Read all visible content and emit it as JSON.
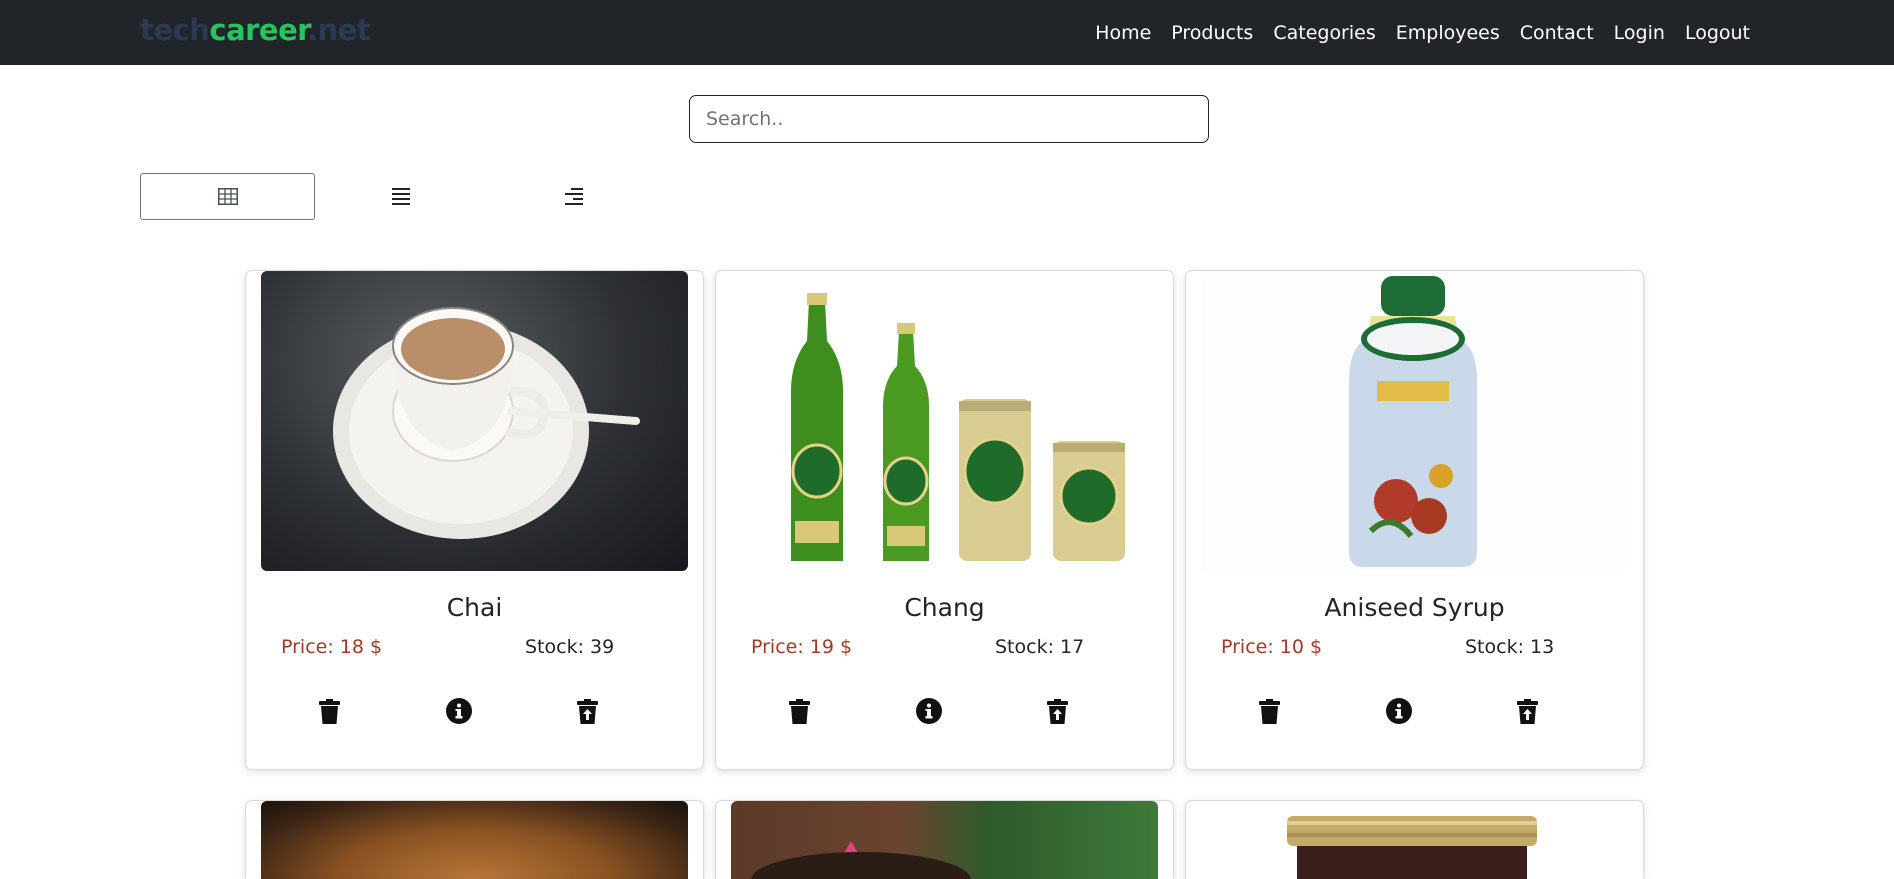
{
  "brand": {
    "part1": "tech",
    "part2": "career",
    "part3": ".net"
  },
  "nav": [
    "Home",
    "Products",
    "Categories",
    "Employees",
    "Contact",
    "Login",
    "Logout"
  ],
  "search": {
    "placeholder": "Search..",
    "value": ""
  },
  "view_toggles": [
    {
      "icon": "grid-icon",
      "active": true
    },
    {
      "icon": "list-icon",
      "active": false
    },
    {
      "icon": "align-right-icon",
      "active": false
    }
  ],
  "products": [
    {
      "name": "Chai",
      "price": "Price: 18 $",
      "stock": "Stock: 39",
      "image": "tea-cup-image"
    },
    {
      "name": "Chang",
      "price": "Price: 19 $",
      "stock": "Stock: 17",
      "image": "beer-bottles-image"
    },
    {
      "name": "Aniseed Syrup",
      "price": "Price: 10 $",
      "stock": "Stock: 13",
      "image": "syrup-bottle-image"
    },
    {
      "name": "",
      "price": "",
      "stock": "",
      "image": "spice-image"
    },
    {
      "name": "",
      "price": "",
      "stock": "",
      "image": "rice-dish-image"
    },
    {
      "name": "",
      "price": "",
      "stock": "",
      "image": "jar-image"
    }
  ],
  "card_actions": [
    "trash-icon",
    "info-icon",
    "trash-arrow-up-icon"
  ],
  "colors": {
    "navbar": "#212529",
    "brand_accent": "#22c55e",
    "price": "#a33a24"
  }
}
